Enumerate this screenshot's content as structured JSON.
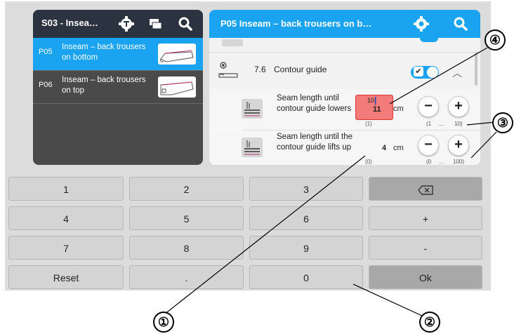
{
  "left_panel": {
    "title": "S03 - Insea…",
    "items": [
      {
        "code": "P05",
        "name": "Inseam – back trousers on bottom",
        "selected": true
      },
      {
        "code": "P06",
        "name": "Inseam – back trousers on top",
        "selected": false
      }
    ]
  },
  "right_panel": {
    "title": "P05 Inseam – back trousers on b…",
    "section": {
      "number": "7.6",
      "label": "Contour guide",
      "toggle_on": true
    },
    "params": [
      {
        "label": "Seam length until contour guide lowers",
        "old_value": "10",
        "new_value": "11",
        "unit": "cm",
        "default": "(1)",
        "range_min": "(1",
        "range_sep": "…",
        "range_max": "10)"
      },
      {
        "label": "Seam length until the contour guide lifts up",
        "value": "4",
        "unit": "cm",
        "default": "(0)",
        "range_min": "(0",
        "range_sep": "…",
        "range_max": "100)"
      }
    ]
  },
  "keypad": {
    "rows": [
      [
        "1",
        "2",
        "3",
        "⌫"
      ],
      [
        "4",
        "5",
        "6",
        "+"
      ],
      [
        "7",
        "8",
        "9",
        "-"
      ],
      [
        "Reset",
        ".",
        "0",
        "Ok"
      ]
    ]
  },
  "callouts": [
    "①",
    "②",
    "③",
    "④"
  ],
  "colors": {
    "accent": "#1aa3f0",
    "dark_header": "#2b3340",
    "highlight": "#f37b79"
  }
}
